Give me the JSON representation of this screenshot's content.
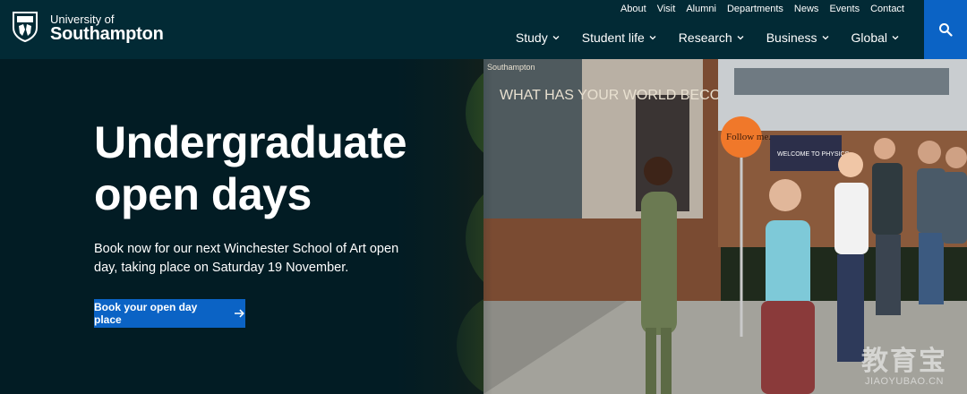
{
  "brand": {
    "line1": "University of",
    "line2": "Southampton"
  },
  "utility_nav": [
    "About",
    "Visit",
    "Alumni",
    "Departments",
    "News",
    "Events",
    "Contact"
  ],
  "main_nav": [
    "Study",
    "Student life",
    "Research",
    "Business",
    "Global"
  ],
  "search": {
    "icon": "search-icon"
  },
  "hero": {
    "title_line1": "Undergraduate",
    "title_line2": "open days",
    "text": "Book now for our next Winchester School of Art open day, taking place on Saturday 19 November.",
    "cta_label": "Book your open day place",
    "poster_text": "WHAT HAS YOUR WORLD BECOME?",
    "poster_brand": "Southampton",
    "sign_text": "Follow me.",
    "banner_text": "WELCOME TO PHYSICS"
  },
  "watermark": {
    "logo": "教育宝",
    "url": "JIAOYUBAO.CN"
  },
  "colors": {
    "header_bg": "#022a35",
    "hero_bg": "#021c24",
    "accent_blue": "#0b63c5",
    "sign_orange": "#f0782a"
  }
}
